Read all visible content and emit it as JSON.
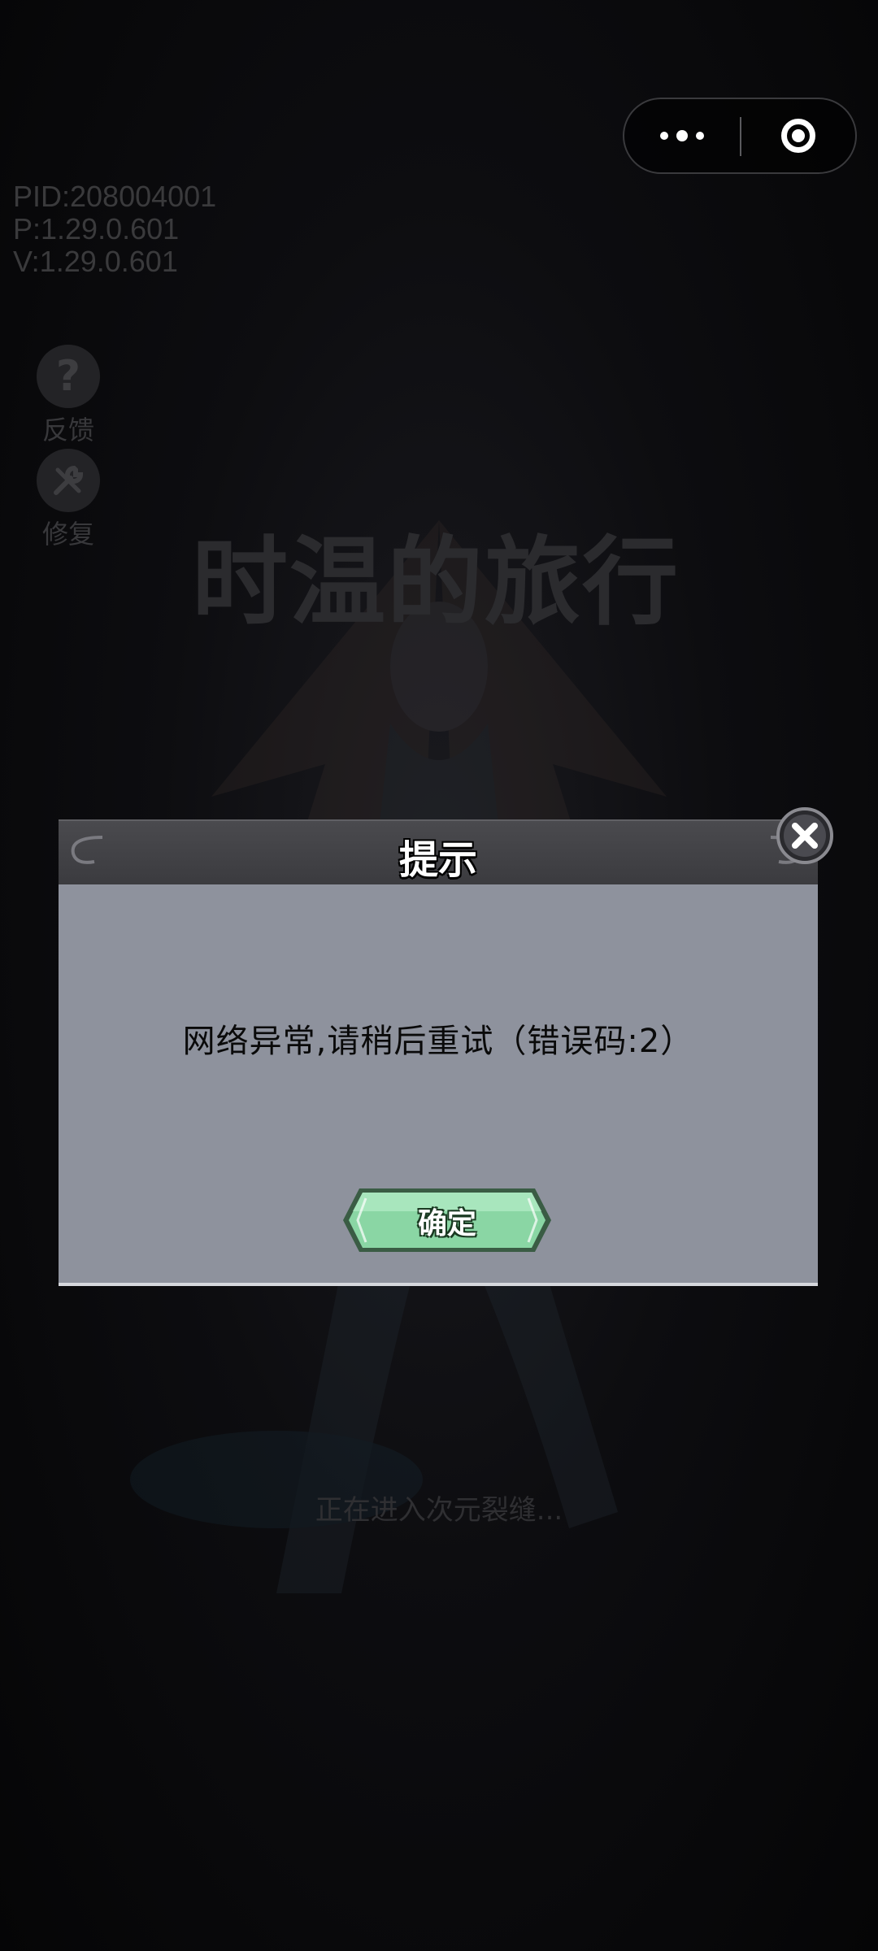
{
  "capsule": {
    "more_icon": "more-dots-icon",
    "close_icon": "target-close-icon"
  },
  "debug_info": {
    "pid": "PID:208004001",
    "p_version": "P:1.29.0.601",
    "v_version": "V:1.29.0.601"
  },
  "side_tools": {
    "feedback": {
      "icon": "question-icon",
      "label": "反馈"
    },
    "repair": {
      "icon": "wrench-icon",
      "label": "修复"
    }
  },
  "game": {
    "title": "时温的旅行",
    "loading_text": "正在进入次元裂缝..."
  },
  "dialog": {
    "title": "提示",
    "message": "网络异常,请稍后重试（错误码:2）",
    "confirm_label": "确定",
    "close_icon": "close-x-icon"
  },
  "colors": {
    "dialog_body": "#8e929d",
    "dialog_header": "#3b3b3f",
    "confirm_green": "#7ccf98"
  }
}
